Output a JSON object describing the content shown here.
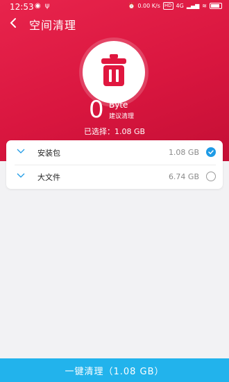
{
  "status_bar": {
    "time": "12:53",
    "left_icons": [
      "weibo-icon",
      "usb-icon"
    ],
    "right_text": [
      "0.00 K/s",
      "HD",
      "4G"
    ]
  },
  "header": {
    "title": "空间清理"
  },
  "summary": {
    "size_value": "0",
    "size_unit": "Byte",
    "size_caption": "建议清理",
    "selected_text": "已选择：1.08 GB"
  },
  "items": [
    {
      "label": "安装包",
      "size": "1.08 GB",
      "checked": true
    },
    {
      "label": "大文件",
      "size": "6.74 GB",
      "checked": false
    }
  ],
  "action": {
    "clean_label": "一键清理（1.08 GB）"
  },
  "colors": {
    "hero": "#d9163f",
    "accent": "#22b3ec",
    "check": "#1e9be6"
  }
}
